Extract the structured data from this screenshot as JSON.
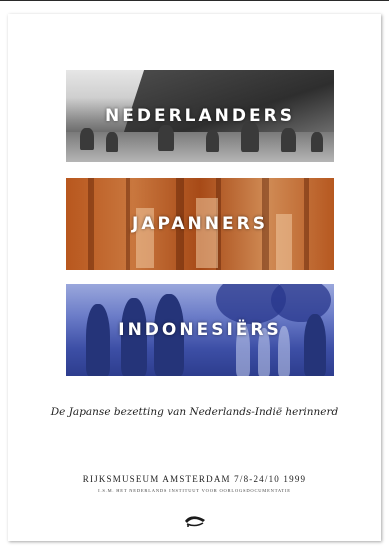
{
  "poster": {
    "panels": [
      {
        "title": "NEDERLANDERS",
        "tone": "#7a7a7a"
      },
      {
        "title": "JAPANNERS",
        "tone": "#b8571e"
      },
      {
        "title": "INDONESIËRS",
        "tone": "#3d4fa6"
      }
    ],
    "subtitle": "De Japanse bezetting van Nederlands-Indië herinnerd",
    "venue": "RIJKSMUSEUM AMSTERDAM 7/8-24/10 1999",
    "partner": "I.S.M. HET NEDERLANDS INSTITUUT VOOR OORLOGSDOCUMENTATIE",
    "logo_icon": "rijksmuseum-logo-icon"
  }
}
